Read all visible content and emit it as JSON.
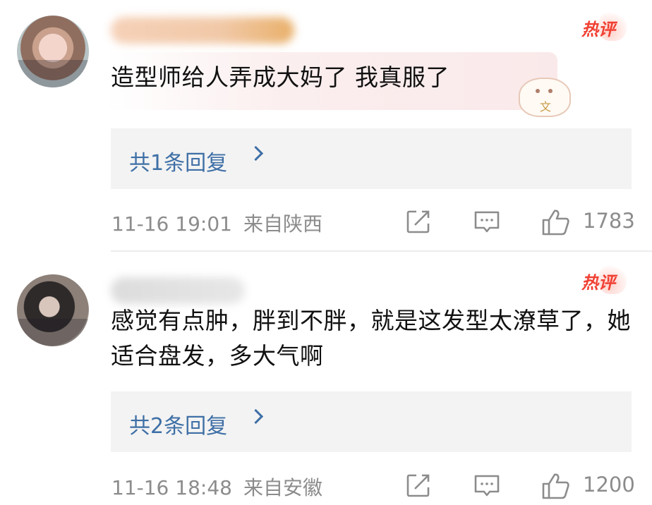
{
  "comments": [
    {
      "badge": "热评",
      "text": "造型师给人弄成大妈了 我真服了",
      "replies_label": "共1条回复",
      "time": "11-16 19:01",
      "location": "来自陕西",
      "likes": "1783"
    },
    {
      "badge": "热评",
      "text": "感觉有点肿，胖到不胖，就是这发型太潦草了，她适合盘发，多大气啊",
      "replies_label": "共2条回复",
      "time": "11-16 18:48",
      "location": "来自安徽",
      "likes": "1200"
    }
  ],
  "icons": {
    "share": "share-icon",
    "comment": "comment-icon",
    "like": "thumbs-up-icon",
    "chevron": "chevron-right-icon"
  },
  "colors": {
    "link": "#3e6fa6",
    "badge": "#f04033",
    "meta": "#8c8c8c",
    "reply_bg": "#f3f3f3"
  }
}
